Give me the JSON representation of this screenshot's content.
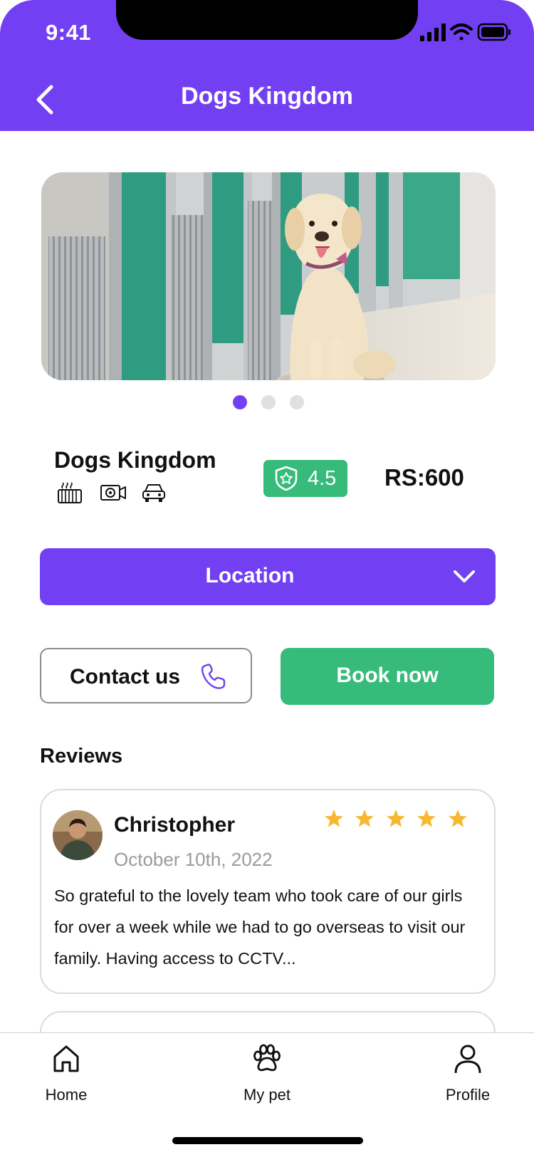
{
  "status_bar": {
    "time": "9:41"
  },
  "header": {
    "title": "Dogs Kingdom",
    "back_icon": "chevron-left-icon"
  },
  "carousel": {
    "slide_count": 3,
    "active_index": 0,
    "active_color": "#7240F2",
    "inactive_color": "#E0E0E0"
  },
  "place": {
    "name": "Dogs Kingdom",
    "amenities": [
      "heater-icon",
      "cctv-camera-icon",
      "car-icon"
    ],
    "rating": "4.5",
    "price": "RS:600"
  },
  "location": {
    "label": "Location",
    "icon": "chevron-down-icon"
  },
  "actions": {
    "contact_label": "Contact us",
    "book_label": "Book now"
  },
  "reviews": {
    "title": "Reviews",
    "items": [
      {
        "name": "Christopher",
        "date": "October 10th, 2022",
        "stars": 5,
        "text": "So grateful to the lovely team who took care of our girls for over a week while we had to go overseas to visit our family. Having access to CCTV..."
      }
    ]
  },
  "nav": {
    "items": [
      {
        "label": "Home"
      },
      {
        "label": "My pet"
      },
      {
        "label": "Profile"
      }
    ]
  },
  "colors": {
    "brand": "#7240F2",
    "success": "#37BB7B",
    "star": "#F5B82E"
  }
}
